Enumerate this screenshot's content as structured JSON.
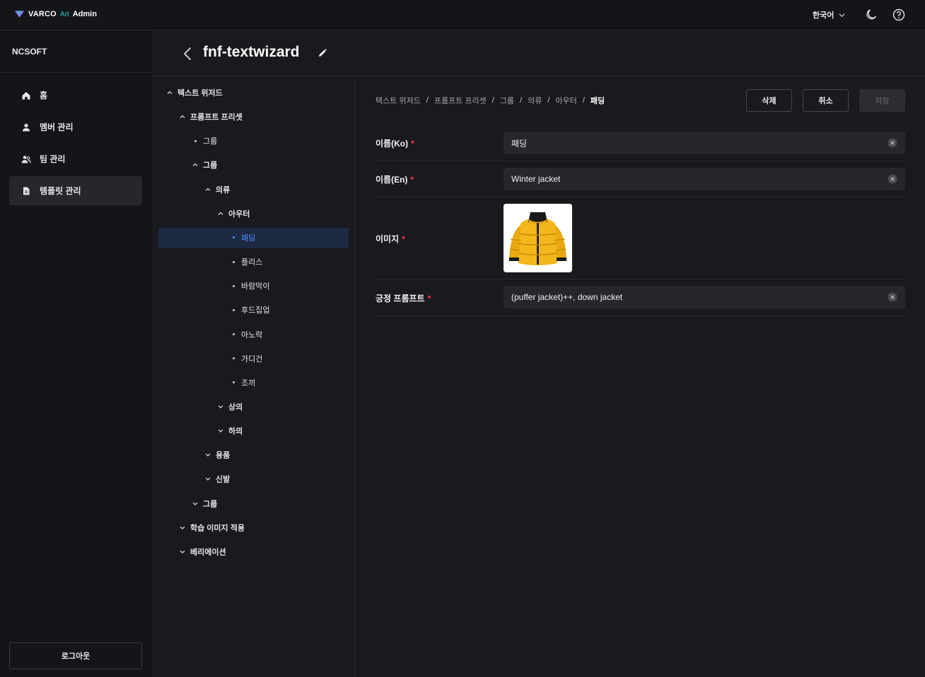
{
  "topbar": {
    "brand_main": "VARCO",
    "brand_art": "Art",
    "brand_admin": "Admin",
    "language": "한국어",
    "icons": [
      "chevron-down-icon",
      "moon-icon",
      "help-icon"
    ]
  },
  "sidebar": {
    "org": "NCSOFT",
    "items": [
      {
        "label": "홈",
        "icon": "home-icon",
        "active": false
      },
      {
        "label": "멤버 관리",
        "icon": "person-icon",
        "active": false
      },
      {
        "label": "팀 관리",
        "icon": "team-icon",
        "active": false
      },
      {
        "label": "템플릿 관리",
        "icon": "document-icon",
        "active": true
      }
    ],
    "logout": "로그아웃"
  },
  "header": {
    "title": "fnf-textwizard"
  },
  "tree": {
    "nodes": [
      {
        "label": "텍스트 위저드",
        "type": "expanded",
        "depth": 0,
        "bold": true
      },
      {
        "label": "프롬프트 프리셋",
        "type": "expanded",
        "depth": 1,
        "bold": true
      },
      {
        "label": "그룹",
        "type": "leaf",
        "depth": 2,
        "bold": false
      },
      {
        "label": "그룹",
        "type": "expanded",
        "depth": 2,
        "bold": true
      },
      {
        "label": "의류",
        "type": "expanded",
        "depth": 3,
        "bold": true
      },
      {
        "label": "아우터",
        "type": "expanded",
        "depth": 4,
        "bold": true
      },
      {
        "label": "패딩",
        "type": "leaf",
        "depth": 5,
        "bold": false,
        "selected": true
      },
      {
        "label": "플리스",
        "type": "leaf",
        "depth": 5,
        "bold": false
      },
      {
        "label": "바람막이",
        "type": "leaf",
        "depth": 5,
        "bold": false
      },
      {
        "label": "후드집업",
        "type": "leaf",
        "depth": 5,
        "bold": false
      },
      {
        "label": "아노락",
        "type": "leaf",
        "depth": 5,
        "bold": false
      },
      {
        "label": "가디건",
        "type": "leaf",
        "depth": 5,
        "bold": false
      },
      {
        "label": "조끼",
        "type": "leaf",
        "depth": 5,
        "bold": false
      },
      {
        "label": "상의",
        "type": "collapsed",
        "depth": 4,
        "bold": true
      },
      {
        "label": "하의",
        "type": "collapsed",
        "depth": 4,
        "bold": true
      },
      {
        "label": "용품",
        "type": "collapsed",
        "depth": 3,
        "bold": true
      },
      {
        "label": "신발",
        "type": "collapsed",
        "depth": 3,
        "bold": true
      },
      {
        "label": "그룹",
        "type": "collapsed",
        "depth": 2,
        "bold": true
      },
      {
        "label": "학습 이미지 적용",
        "type": "collapsed",
        "depth": 1,
        "bold": true
      },
      {
        "label": "베리에이션",
        "type": "collapsed",
        "depth": 1,
        "bold": true
      }
    ]
  },
  "breadcrumb": [
    "텍스트 위저드",
    "프롬프트 프리셋",
    "그룹",
    "의류",
    "아우터",
    "패딩"
  ],
  "actions": {
    "delete": "삭제",
    "cancel": "취소",
    "save": "저장"
  },
  "form": {
    "name_ko": {
      "label": "이름(Ko)",
      "value": "패딩"
    },
    "name_en": {
      "label": "이름(En)",
      "value": "Winter jacket"
    },
    "image": {
      "label": "이미지"
    },
    "positive_prompt": {
      "label": "긍정 프롬프트",
      "value": "(puffer jacket)++, down jacket"
    }
  },
  "colors": {
    "accent": "#4e8fff",
    "required": "#ff3b3b",
    "jacket": "#f2b81b"
  }
}
